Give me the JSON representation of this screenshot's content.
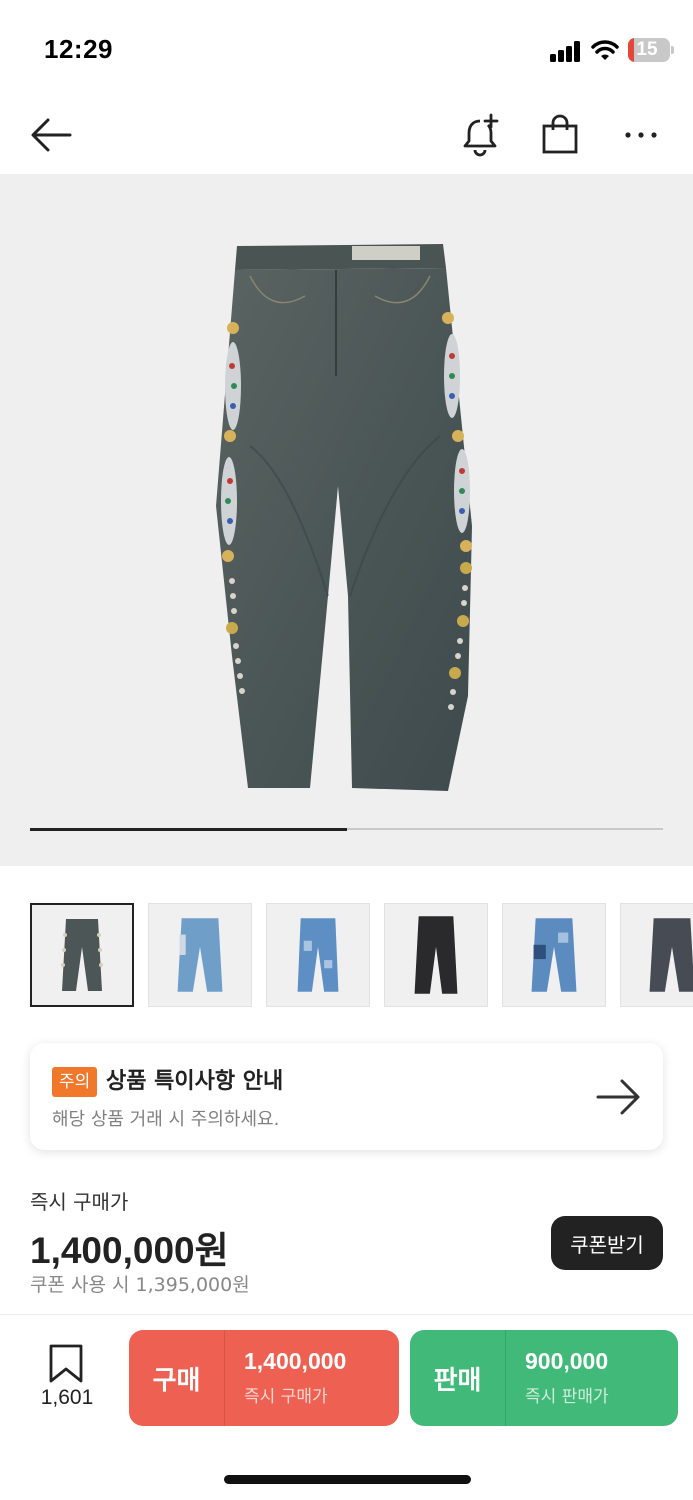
{
  "status_bar": {
    "time": "12:29",
    "battery_level": "15",
    "icons": [
      "signal-icon",
      "wifi-icon",
      "battery-icon"
    ]
  },
  "nav": {
    "icons": [
      "back-arrow-icon",
      "bell-plus-icon",
      "shopping-bag-icon",
      "more-dots-icon"
    ]
  },
  "gallery": {
    "progress": 0.5,
    "thumbnails": [
      "thumb-1",
      "thumb-2",
      "thumb-3",
      "thumb-4",
      "thumb-5",
      "thumb-6"
    ]
  },
  "notice": {
    "badge": "주의",
    "title": "상품 특이사항 안내",
    "subtitle": "해당 상품 거래 시 주의하세요."
  },
  "price": {
    "label": "즉시 구매가",
    "amount": "1,400,000원",
    "coupon_price": "쿠폰 사용 시 1,395,000원",
    "coupon_button": "쿠폰받기"
  },
  "bottom_bar": {
    "bookmark_count": "1,601",
    "buy": {
      "label": "구매",
      "price": "1,400,000",
      "sub": "즉시 구매가"
    },
    "sell": {
      "label": "판매",
      "price": "900,000",
      "sub": "즉시 판매가"
    }
  },
  "colors": {
    "buy": "#ee6152",
    "sell": "#41b979",
    "badge": "#f1772a",
    "dark": "#222222",
    "image_bg": "#efefef"
  }
}
